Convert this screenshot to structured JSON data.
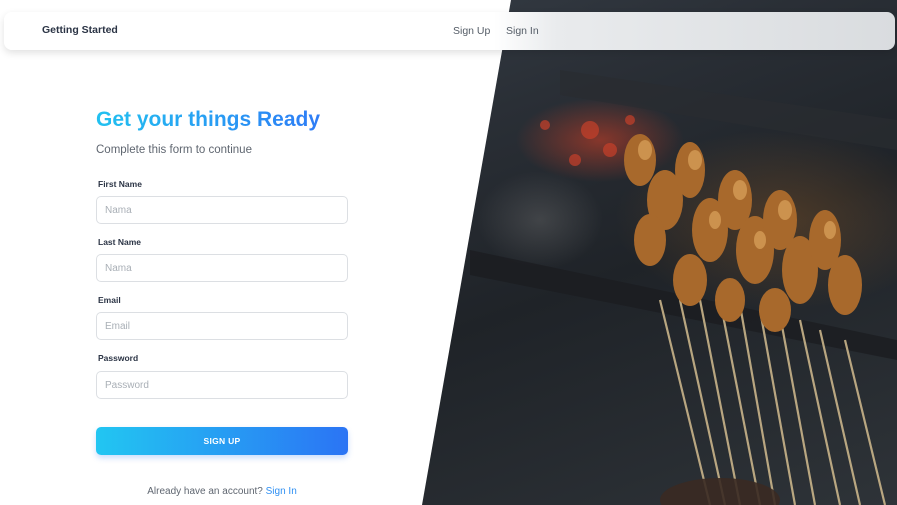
{
  "navbar": {
    "brand": "Getting Started",
    "links": [
      {
        "label": "Sign Up"
      },
      {
        "label": "Sign In"
      }
    ]
  },
  "form": {
    "title": "Get your things Ready",
    "subtitle": "Complete this form to continue",
    "fields": [
      {
        "label": "First Name",
        "placeholder": "Nama",
        "value": ""
      },
      {
        "label": "Last Name",
        "placeholder": "Nama",
        "value": ""
      },
      {
        "label": "Email",
        "placeholder": "Email",
        "value": ""
      },
      {
        "label": "Password",
        "placeholder": "Password",
        "value": ""
      }
    ],
    "submit_label": "SIGN UP",
    "footer_text": "Already have an account?",
    "footer_link": "Sign In"
  },
  "colors": {
    "accent_start": "#22c6f2",
    "accent_end": "#2b74f4",
    "text_dark": "#2b3445"
  }
}
